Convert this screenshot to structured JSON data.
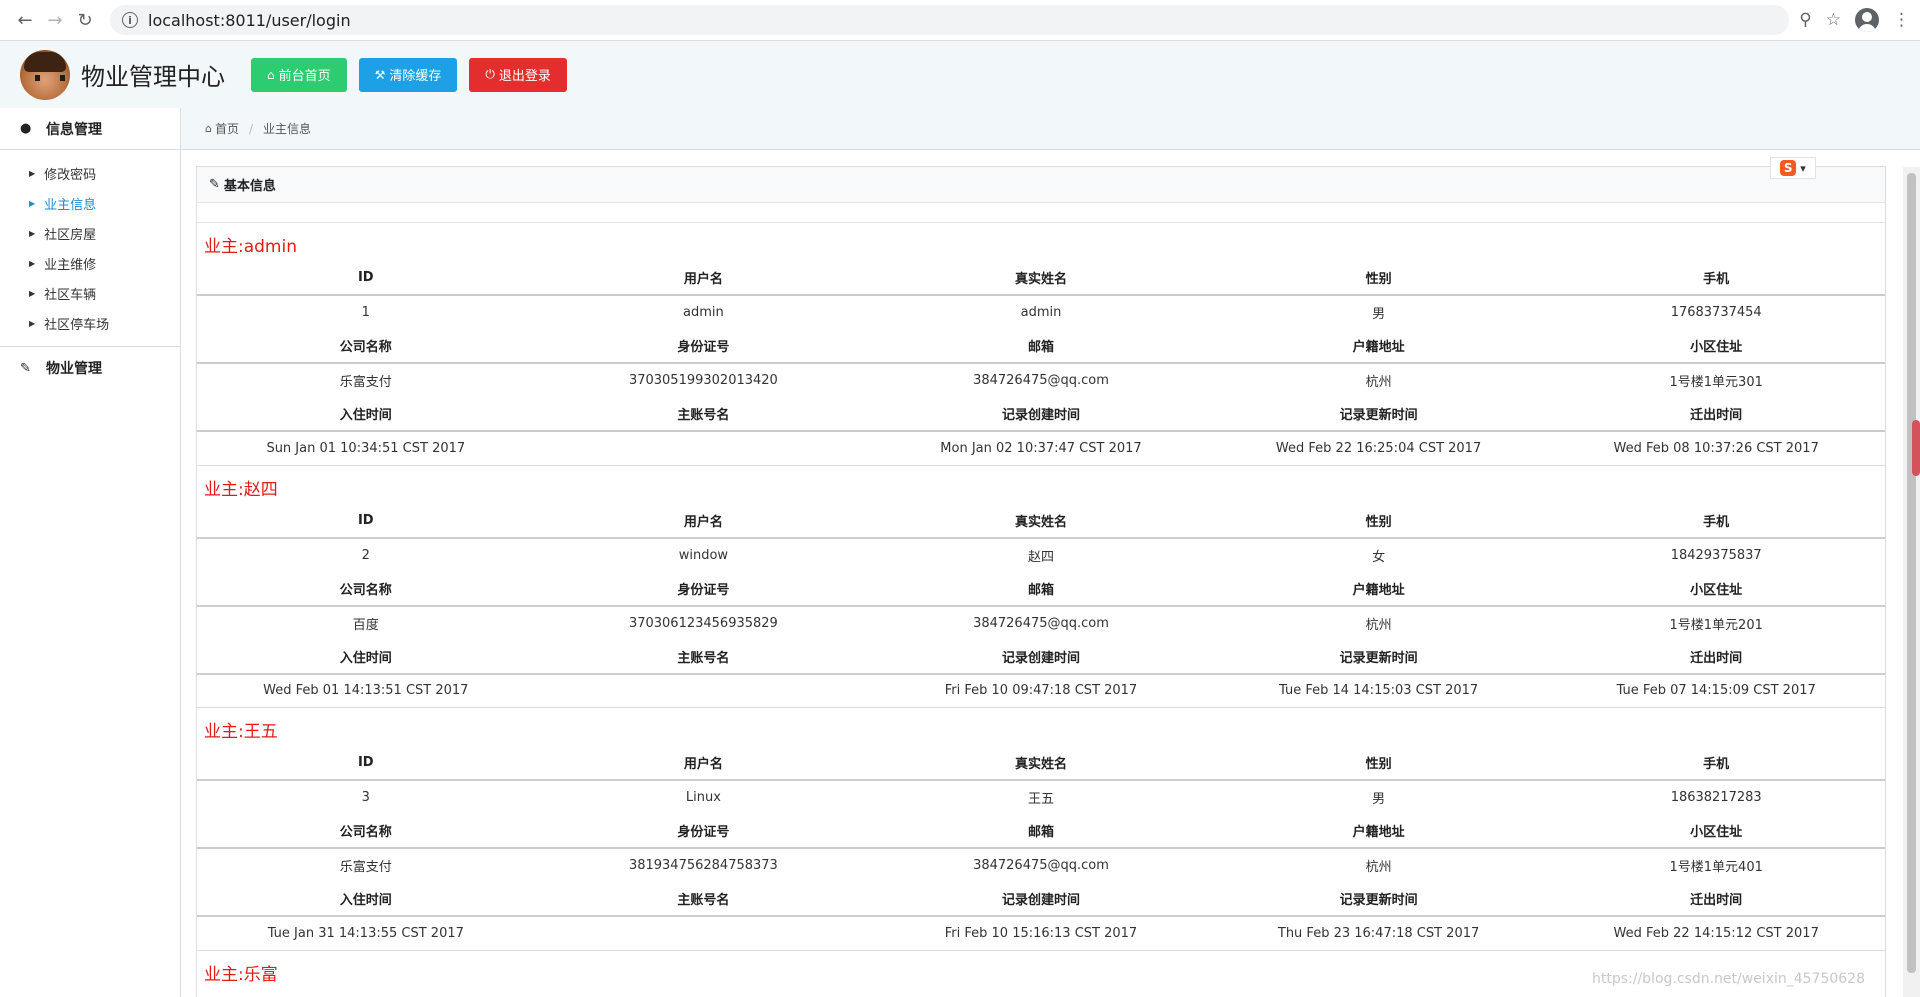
{
  "browser": {
    "url": "localhost:8011/user/login"
  },
  "header": {
    "title": "物业管理中心",
    "buttons": {
      "home": "前台首页",
      "clear_cache": "清除缓存",
      "logout": "退出登录"
    },
    "colors": {
      "home": "#2ecc71",
      "clear_cache": "#1da0e5",
      "logout": "#e42d2d"
    }
  },
  "sidebar": {
    "group1": "信息管理",
    "items": [
      "修改密码",
      "业主信息",
      "社区房屋",
      "业主维修",
      "社区车辆",
      "社区停车场"
    ],
    "active_index": 1,
    "group2": "物业管理"
  },
  "breadcrumb": {
    "home": "首页",
    "current": "业主信息"
  },
  "panel": {
    "title": "基本信息"
  },
  "labels": {
    "row1": [
      "ID",
      "用户名",
      "真实姓名",
      "性别",
      "手机"
    ],
    "row2": [
      "公司名称",
      "身份证号",
      "邮箱",
      "户籍地址",
      "小区住址"
    ],
    "row3": [
      "入住时间",
      "主账号名",
      "记录创建时间",
      "记录更新时间",
      "迁出时间"
    ]
  },
  "owners": [
    {
      "title": "业主:admin",
      "row1": [
        "1",
        "admin",
        "admin",
        "男",
        "17683737454"
      ],
      "row2": [
        "乐富支付",
        "370305199302013420",
        "384726475@qq.com",
        "杭州",
        "1号楼1单元301"
      ],
      "row3": [
        "Sun Jan 01 10:34:51 CST 2017",
        "",
        "Mon Jan 02 10:37:47 CST 2017",
        "Wed Feb 22 16:25:04 CST 2017",
        "Wed Feb 08 10:37:26 CST 2017"
      ]
    },
    {
      "title": "业主:赵四",
      "row1": [
        "2",
        "window",
        "赵四",
        "女",
        "18429375837"
      ],
      "row2": [
        "百度",
        "370306123456935829",
        "384726475@qq.com",
        "杭州",
        "1号楼1单元201"
      ],
      "row3": [
        "Wed Feb 01 14:13:51 CST 2017",
        "",
        "Fri Feb 10 09:47:18 CST 2017",
        "Tue Feb 14 14:15:03 CST 2017",
        "Tue Feb 07 14:15:09 CST 2017"
      ]
    },
    {
      "title": "业主:王五",
      "row1": [
        "3",
        "Linux",
        "王五",
        "男",
        "18638217283"
      ],
      "row2": [
        "乐富支付",
        "381934756284758373",
        "384726475@qq.com",
        "杭州",
        "1号楼1单元401"
      ],
      "row3": [
        "Tue Jan 31 14:13:55 CST 2017",
        "",
        "Fri Feb 10 15:16:13 CST 2017",
        "Thu Feb 23 16:47:18 CST 2017",
        "Wed Feb 22 14:15:12 CST 2017"
      ]
    },
    {
      "title": "业主:乐富"
    }
  ],
  "watermark": "https://blog.csdn.net/weixin_45750628"
}
